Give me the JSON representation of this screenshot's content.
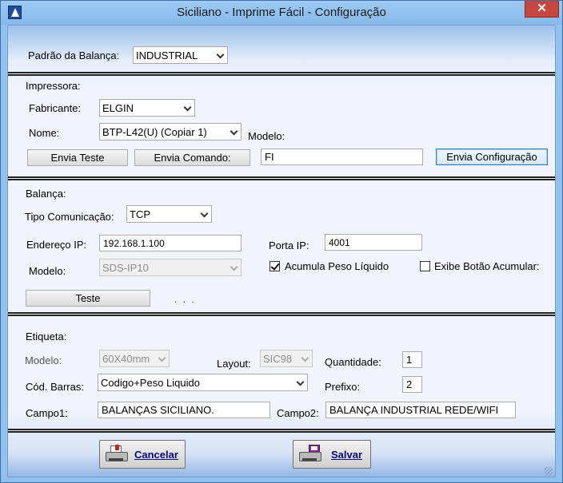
{
  "window": {
    "title": "Siciliano - Imprime Fácil - Configuração",
    "close_glyph": "✕"
  },
  "balanca_padrao": {
    "label": "Padrão da Balança:",
    "value": "INDUSTRIAL"
  },
  "impressora": {
    "section_label": "Impressora:",
    "fabricante_label": "Fabricante:",
    "fabricante_value": "ELGIN",
    "nome_label": "Nome:",
    "nome_value": "BTP-L42(U) (Copiar 1)",
    "modelo_label": "Modelo:",
    "modelo_value": "FI",
    "envia_teste": "Envia Teste",
    "envia_comando": "Envia Comando:",
    "envia_configuracao": "Envia Configuração"
  },
  "balanca": {
    "section_label": "Balança:",
    "tipo_label": "Tipo Comunicação:",
    "tipo_value": "TCP",
    "endereco_label": "Endereço IP:",
    "endereco_value": "192.168.1.100",
    "porta_label": "Porta IP:",
    "porta_value": "4001",
    "modelo_label": "Modelo:",
    "modelo_value": "SDS-IP10",
    "acumula_label": "Acumula Peso Líquido",
    "acumula_checked": true,
    "exibe_label": "Exibe Botão Acumular:",
    "exibe_checked": false,
    "teste": "Teste",
    "status_dots": ". . ."
  },
  "etiqueta": {
    "section_label": "Etiqueta:",
    "modelo_label": "Modelo:",
    "modelo_value": "60X40mm",
    "layout_label": "Layout:",
    "layout_value": "SIC98",
    "quantidade_label": "Quantidade:",
    "quantidade_value": "1",
    "cod_barras_label": "Cód. Barras:",
    "cod_barras_value": "Codigo+Peso Liquido",
    "prefixo_label": "Prefixo:",
    "prefixo_value": "2",
    "campo1_label": "Campo1:",
    "campo1_value": "BALANÇAS SICILIANO.",
    "campo2_label": "Campo2:",
    "campo2_value": "BALANÇA INDUSTRIAL REDE/WIFI"
  },
  "footer": {
    "cancelar": "Cancelar",
    "salvar": "Salvar"
  },
  "icons": [
    "app-logo-icon",
    "close-icon",
    "chevron-down-icon",
    "checkbox-icon",
    "printer-icon",
    "save-disk-icon",
    "resize-grip-icon"
  ]
}
